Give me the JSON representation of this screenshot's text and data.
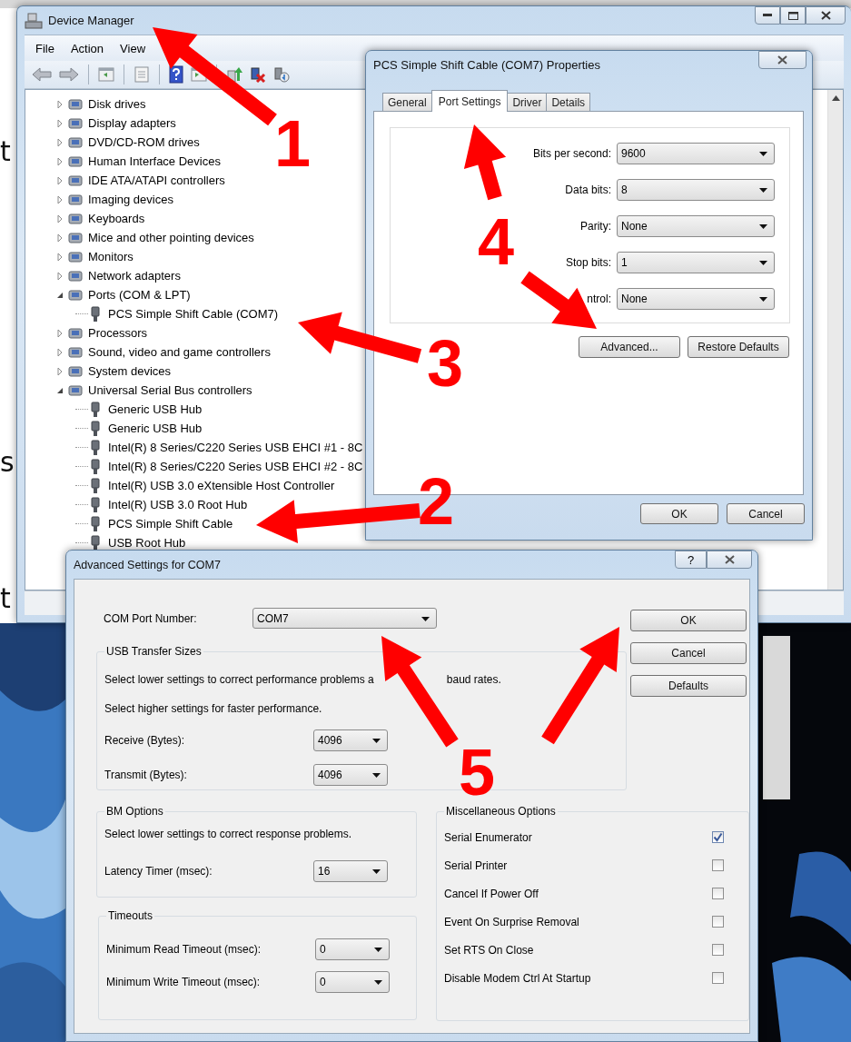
{
  "background_text": [
    "t",
    "s",
    "t"
  ],
  "device_manager": {
    "title": "Device Manager",
    "menu": [
      "File",
      "Action",
      "View"
    ],
    "tree": [
      {
        "label": "Disk drives",
        "expanded": false
      },
      {
        "label": "Display adapters",
        "expanded": false
      },
      {
        "label": "DVD/CD-ROM drives",
        "expanded": false
      },
      {
        "label": "Human Interface Devices",
        "expanded": false
      },
      {
        "label": "IDE ATA/ATAPI controllers",
        "expanded": false
      },
      {
        "label": "Imaging devices",
        "expanded": false
      },
      {
        "label": "Keyboards",
        "expanded": false
      },
      {
        "label": "Mice and other pointing devices",
        "expanded": false
      },
      {
        "label": "Monitors",
        "expanded": false
      },
      {
        "label": "Network adapters",
        "expanded": false
      },
      {
        "label": "Ports (COM & LPT)",
        "expanded": true,
        "children": [
          {
            "label": "PCS Simple Shift Cable (COM7)"
          }
        ]
      },
      {
        "label": "Processors",
        "expanded": false
      },
      {
        "label": "Sound, video and game controllers",
        "expanded": false
      },
      {
        "label": "System devices",
        "expanded": false
      },
      {
        "label": "Universal Serial Bus controllers",
        "expanded": true,
        "children": [
          {
            "label": "Generic USB Hub"
          },
          {
            "label": "Generic USB Hub"
          },
          {
            "label": "Intel(R) 8 Series/C220 Series USB EHCI #1 - 8C"
          },
          {
            "label": "Intel(R) 8 Series/C220 Series USB EHCI #2 - 8C"
          },
          {
            "label": "Intel(R) USB 3.0 eXtensible Host Controller"
          },
          {
            "label": "Intel(R) USB 3.0 Root Hub"
          },
          {
            "label": "PCS Simple Shift Cable"
          },
          {
            "label": "USB Root Hub"
          }
        ]
      }
    ]
  },
  "properties": {
    "title": "PCS Simple Shift Cable (COM7) Properties",
    "tabs": [
      {
        "label": "General",
        "selected": false
      },
      {
        "label": "Port Settings",
        "selected": true
      },
      {
        "label": "Driver",
        "selected": false
      },
      {
        "label": "Details",
        "selected": false
      }
    ],
    "fields": [
      {
        "label": "Bits per second:",
        "value": "9600"
      },
      {
        "label": "Data bits:",
        "value": "8"
      },
      {
        "label": "Parity:",
        "value": "None"
      },
      {
        "label": "Stop bits:",
        "value": "1"
      },
      {
        "label": "ntrol:",
        "value": "None"
      }
    ],
    "buttons": [
      "Advanced...",
      "Restore Defaults"
    ],
    "footer_buttons": [
      "OK",
      "Cancel"
    ]
  },
  "advanced": {
    "title": "Advanced Settings for COM7",
    "help_button": "?",
    "com_port": {
      "label": "COM Port Number:",
      "value": "COM7"
    },
    "buttons": [
      "OK",
      "Cancel",
      "Defaults"
    ],
    "usb_transfer": {
      "title": "USB Transfer Sizes",
      "notes": [
        {
          "parts": [
            "Select lower settings to correct performance problems a",
            "baud rates."
          ]
        },
        {
          "parts": [
            "Select higher settings for faster performance."
          ]
        }
      ],
      "fields": [
        {
          "label": "Receive (Bytes):",
          "value": "4096"
        },
        {
          "label": "Transmit (Bytes):",
          "value": "4096"
        }
      ]
    },
    "bm_options": {
      "title": "BM Options",
      "note": "Select lower settings to correct response problems.",
      "fields": [
        {
          "label": "Latency Timer (msec):",
          "value": "16"
        }
      ]
    },
    "timeouts": {
      "title": "Timeouts",
      "fields": [
        {
          "label": "Minimum Read Timeout (msec):",
          "value": "0"
        },
        {
          "label": "Minimum Write Timeout (msec):",
          "value": "0"
        }
      ]
    },
    "misc": {
      "title": "Miscellaneous Options",
      "options": [
        {
          "label": "Serial Enumerator",
          "checked": true
        },
        {
          "label": "Serial Printer",
          "checked": false
        },
        {
          "label": "Cancel If Power Off",
          "checked": false
        },
        {
          "label": "Event On Surprise Removal",
          "checked": false
        },
        {
          "label": "Set RTS On Close",
          "checked": false
        },
        {
          "label": "Disable Modem Ctrl At Startup",
          "checked": false
        }
      ]
    }
  },
  "annotations": [
    {
      "label": "1"
    },
    {
      "label": "2"
    },
    {
      "label": "3"
    },
    {
      "label": "4"
    },
    {
      "label": "5"
    }
  ]
}
